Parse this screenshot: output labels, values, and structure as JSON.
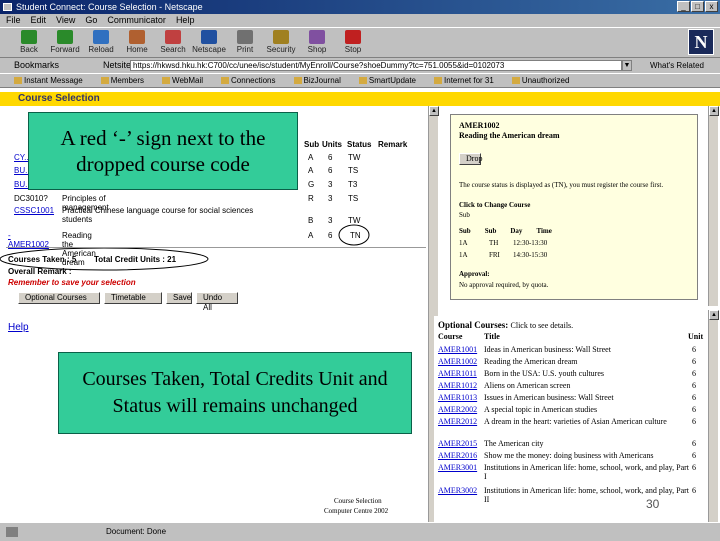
{
  "window": {
    "title": "Student Connect: Course Selection - Netscape",
    "buttons": [
      "_",
      "□",
      "x"
    ]
  },
  "menu": [
    "File",
    "Edit",
    "View",
    "Go",
    "Communicator",
    "Help"
  ],
  "toolbar": [
    "Back",
    "Forward",
    "Reload",
    "Home",
    "Search",
    "Netscape",
    "Print",
    "Security",
    "Shop",
    "Stop"
  ],
  "toolbar_colors": [
    "#2a8a2a",
    "#2a8a2a",
    "#3070c0",
    "#b06030",
    "#c04040",
    "#2050a0",
    "#707070",
    "#a08020",
    "#8050a0",
    "#c02020"
  ],
  "location": {
    "bookmarks_label": "Bookmarks",
    "netsite_label": "Netsite:",
    "url": "https://hkwsd.hku.hk:C700/cc/unee/isc/student/MyEnroll/Course?shoeDummy?tc=751.0055&id=0102073",
    "whats_related": "What's Related"
  },
  "personal_bar": [
    "Instant Message",
    "Members",
    "WebMail",
    "Connections",
    "BizJournal",
    "SmartUpdate",
    "Internet for 31",
    "Unauthorized"
  ],
  "page": {
    "section_title": "Course Selection",
    "table_headers": [
      "Sub",
      "Units",
      "Status",
      "Remark"
    ],
    "rows": [
      {
        "code": "CY...",
        "title": "",
        "sub": "A",
        "units": "6",
        "status": "TW"
      },
      {
        "code": "BU...",
        "title": "",
        "sub": "A",
        "units": "6",
        "status": "TS"
      },
      {
        "code": "BU...",
        "title": "",
        "sub": "G",
        "units": "3",
        "status": "T3"
      },
      {
        "code": "DC3010?",
        "title": "Principles of management",
        "sub": "R",
        "units": "3",
        "status": "TS"
      },
      {
        "code": "CSSC1001",
        "title": "Practical Chinese language course for social sciences students",
        "sub": "B",
        "units": "3",
        "status": "TW"
      },
      {
        "code": "- AMER1002",
        "title": "Reading the American dream",
        "sub": "A",
        "units": "6",
        "status": "TN"
      }
    ],
    "courses_taken": "Courses Taken : 5",
    "total_credit": "Total Credit Units : 21",
    "overall_remark": "Overall Remark :",
    "remember": "Remember to save your selection",
    "buttons": [
      "Optional Courses",
      "Timetable",
      "Save",
      "Undo All"
    ],
    "help_link": "Help",
    "footer_line1": "Course Selection",
    "footer_line2": "Computer Centre 2002"
  },
  "detail_panel": {
    "code": "AMER1002",
    "title": "Reading the American dream",
    "drop_button": "Drop",
    "message": "The course status is displayed as (TN), you must register the course first.",
    "change_course": "Click to Change Course",
    "subclass_label": "Sub",
    "sub_headers": [
      "Sub",
      "Sub",
      "Day",
      "Time"
    ],
    "sub_rows": [
      [
        "1A",
        "",
        "TH",
        "12:30-13:30"
      ],
      [
        "1A",
        "",
        "FRI",
        "14:30-15:30"
      ]
    ],
    "approval_label": "Approval:",
    "approval_text": "No approval required, by quota."
  },
  "optional_courses": {
    "heading": "Optional Courses:",
    "hint": "Click to see details.",
    "col_course": "Course",
    "col_title": "Title",
    "col_unit": "Unit",
    "rows": [
      {
        "code": "AMER1001",
        "title": "Ideas in American business: Wall Street",
        "unit": "6"
      },
      {
        "code": "AMER1002",
        "title": "Reading the American dream",
        "unit": "6"
      },
      {
        "code": "AMER1011",
        "title": "Born in the USA: U.S. youth cultures",
        "unit": "6"
      },
      {
        "code": "AMER1012",
        "title": "Aliens on American screen",
        "unit": "6"
      },
      {
        "code": "AMER1013",
        "title": "Issues in American business: Wall Street",
        "unit": "6"
      },
      {
        "code": "AMER2002",
        "title": "A special topic in American studies",
        "unit": "6"
      },
      {
        "code": "AMER2012",
        "title": "A dream in the heart: varieties of Asian American culture",
        "unit": "6"
      },
      {
        "code": "AMER2015",
        "title": "The American city",
        "unit": "6"
      },
      {
        "code": "AMER2016",
        "title": "Show me the money: doing business with Americans",
        "unit": "6"
      },
      {
        "code": "AMER3001",
        "title": "Institutions in American life: home, school, work, and play, Part I",
        "unit": "6"
      },
      {
        "code": "AMER3002",
        "title": "Institutions in American life: home, school, work, and play, Part II",
        "unit": "6"
      }
    ]
  },
  "annotations": {
    "callout_top": "A red ‘-’ sign next to the dropped course code",
    "callout_bottom": "Courses Taken, Total Credits Unit and Status will remains unchanged",
    "slide_number": "30"
  },
  "status_bar": {
    "text": "Document: Done"
  },
  "colors": {
    "callout_bg": "#33cc99",
    "section_bar": "#ffd800",
    "link": "#0000cc",
    "remember_red": "#cc0000"
  }
}
